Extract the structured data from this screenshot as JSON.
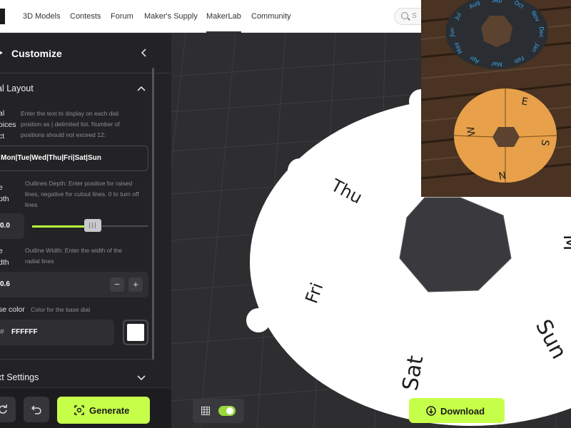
{
  "nav": {
    "items": [
      "3D Models",
      "Contests",
      "Forum",
      "Maker's Supply",
      "MakerLab",
      "Community"
    ],
    "active_index": 4,
    "search_placeholder": "S"
  },
  "sidebar": {
    "title": "Customize",
    "sections": {
      "dial_layout": {
        "label": "al Layout",
        "expanded": true
      },
      "text_settings": {
        "label": "xt Settings",
        "expanded": false
      }
    },
    "dial_choices": {
      "label_line1": "al",
      "label_line2": "oices",
      "label_line3": "ct",
      "desc_line1": "Enter the text to display on each dial",
      "desc_line2": "position as | delimited list. Number of",
      "desc_line3": "positions should not exceed 12:",
      "value": "Mon|Tue|Wed|Thu|Fri|Sat|Sun"
    },
    "outline_depth": {
      "label_line1": "e",
      "label_line2": "pth",
      "desc_line1": "Outlines Depth: Enter positive for raised",
      "desc_line2": "lines, negative for cutout lines. 0 to turn off",
      "desc_line3": "lines",
      "value": "0.0",
      "slider_fraction": 0.52
    },
    "outline_width": {
      "label_line1": "e",
      "label_line2": "dth",
      "desc_line1": "Outline Width: Enter the width of the",
      "desc_line2": "radial lines",
      "value": "0.6",
      "minus": "−",
      "plus": "+"
    },
    "base_color": {
      "label": "se color",
      "desc": "Color for the base dial",
      "hash": "#",
      "hex": "FFFFFF",
      "swatch_color": "#ffffff"
    },
    "buttons": {
      "generate": "Generate"
    }
  },
  "viewport": {
    "dial_labels": [
      "Thu",
      "Fri",
      "Sat",
      "Sun",
      "M"
    ],
    "download": "Download",
    "grid_toggle_on": true
  },
  "photo": {
    "dark_dial_months": [
      "Jul",
      "Aug",
      "Sep",
      "Oct",
      "Nov",
      "Dec",
      "Jan",
      "Feb",
      "Mar",
      "Apr",
      "May",
      "Jun"
    ],
    "orange_dial_directions": [
      "E",
      "S",
      "N",
      "W"
    ]
  },
  "colors": {
    "accent": "#c6ff4a",
    "sidebar_bg": "#232326",
    "viewport_bg": "#2e2e31"
  }
}
